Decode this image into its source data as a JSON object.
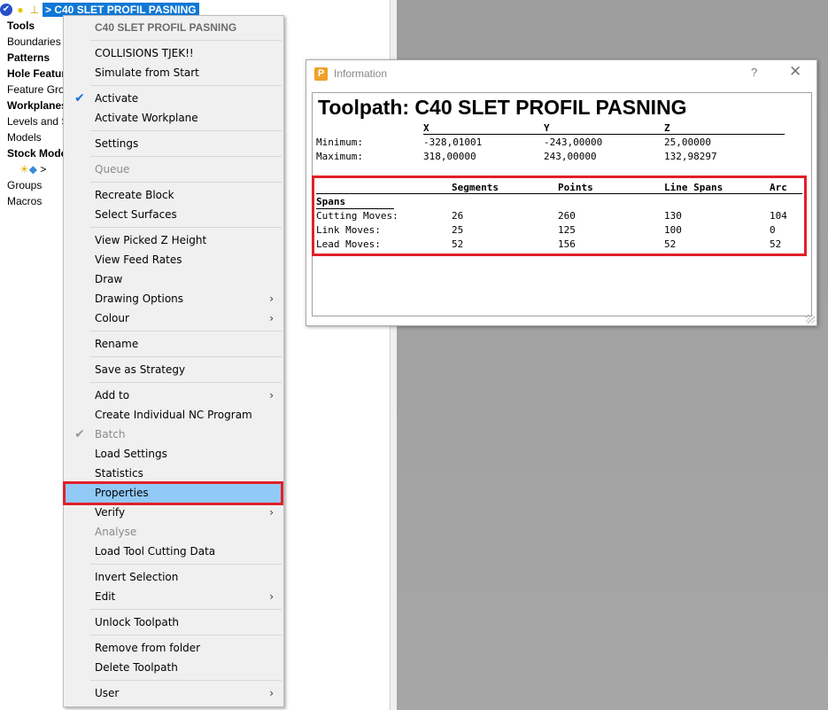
{
  "explorer": {
    "toolpath_label": "> C40 SLET PROFIL PASNING",
    "items": [
      {
        "label": "Tools",
        "bold": true
      },
      {
        "label": "Boundaries",
        "bold": false
      },
      {
        "label": "Patterns",
        "bold": true
      },
      {
        "label": "Hole Featur",
        "bold": true
      },
      {
        "label": "Feature Grou",
        "bold": false
      },
      {
        "label": "Workplanes",
        "bold": true
      },
      {
        "label": "Levels and S",
        "bold": false
      },
      {
        "label": "Models",
        "bold": false
      },
      {
        "label": "Stock Mode",
        "bold": true
      },
      {
        "label": ">",
        "bold": false
      },
      {
        "label": "Groups",
        "bold": false
      },
      {
        "label": "Macros",
        "bold": false
      }
    ]
  },
  "context_menu": {
    "header": "C40 SLET PROFIL PASNING",
    "items": {
      "collisions": "COLLISIONS TJEK!!",
      "simulate": "Simulate from Start",
      "activate": "Activate",
      "activate_workplane": "Activate Workplane",
      "settings": "Settings",
      "queue": "Queue",
      "recreate_block": "Recreate Block",
      "select_surfaces": "Select Surfaces",
      "view_picked_z": "View Picked Z Height",
      "view_feed_rates": "View Feed Rates",
      "draw": "Draw",
      "drawing_options": "Drawing Options",
      "colour": "Colour",
      "rename": "Rename",
      "save_strategy": "Save as Strategy",
      "add_to": "Add to",
      "create_nc": "Create Individual NC Program",
      "batch": "Batch",
      "load_settings": "Load Settings",
      "statistics": "Statistics",
      "properties": "Properties",
      "verify": "Verify",
      "analyse": "Analyse",
      "load_tool_cutting": "Load Tool Cutting Data",
      "invert_selection": "Invert Selection",
      "edit": "Edit",
      "unlock_toolpath": "Unlock Toolpath",
      "remove_from_folder": "Remove from folder",
      "delete_toolpath": "Delete Toolpath",
      "user": "User"
    },
    "submenu_arrow": "›",
    "check_glyph": "✔"
  },
  "dialog": {
    "title": "Information",
    "help": "?",
    "close": "✕",
    "heading": "Toolpath: C40 SLET PROFIL PASNING",
    "axes": {
      "x": "X",
      "y": "Y",
      "z": "Z"
    },
    "minimum": {
      "label": "Minimum:",
      "x": "-328,01001",
      "y": "-243,00000",
      "z": "25,00000"
    },
    "maximum": {
      "label": "Maximum:",
      "x": "318,00000",
      "y": "243,00000",
      "z": "132,98297"
    },
    "spans": {
      "title": "Spans",
      "columns": [
        "Segments",
        "Points",
        "Line Spans",
        "Arc"
      ],
      "rows": [
        {
          "label": "Cutting Moves:",
          "values": [
            "26",
            "260",
            "130",
            "104"
          ]
        },
        {
          "label": "Link Moves:",
          "values": [
            "25",
            "125",
            "100",
            "0"
          ]
        },
        {
          "label": "Lead Moves:",
          "values": [
            "52",
            "156",
            "52",
            "52"
          ]
        }
      ]
    }
  },
  "colors": {
    "selection_blue": "#0f78d6",
    "menu_highlight": "#91c9f7",
    "annotation_red": "#e0202a",
    "viewport_gray": "#a2a2a2"
  }
}
